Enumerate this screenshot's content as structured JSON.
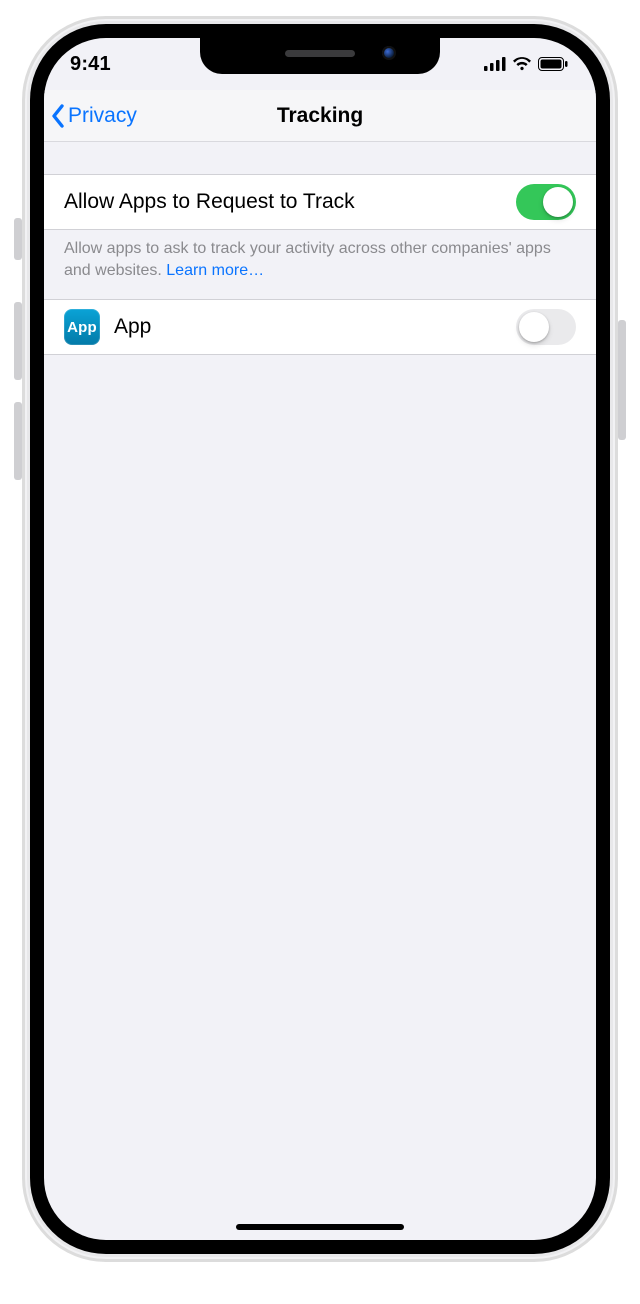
{
  "status": {
    "time": "9:41"
  },
  "nav": {
    "back_label": "Privacy",
    "title": "Tracking"
  },
  "primary": {
    "label": "Allow Apps to Request to Track",
    "on": true
  },
  "footer": {
    "text": "Allow apps to ask to track your activity across other companies' apps and websites. ",
    "learn_more": "Learn more…"
  },
  "apps": [
    {
      "icon_label": "App",
      "name": "App",
      "on": false
    }
  ]
}
